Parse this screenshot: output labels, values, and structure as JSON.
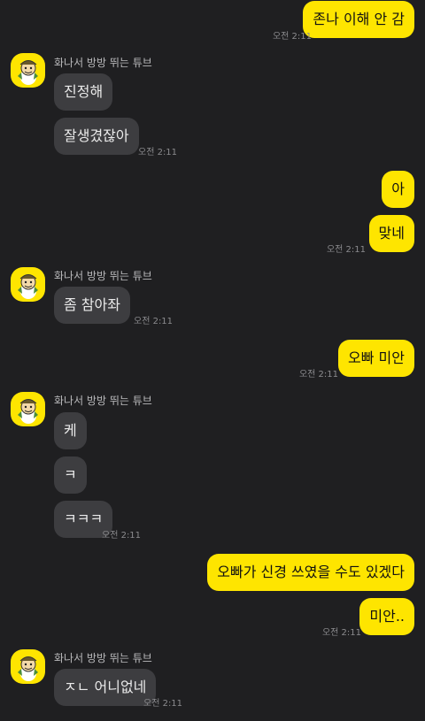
{
  "sender_name": "화나서 방방 뛰는 튜브",
  "messages": [
    {
      "id": "m1",
      "side": "me",
      "text": "존나 이해 안 감",
      "time": "오전 2:11"
    },
    {
      "id": "m2",
      "side": "them",
      "text": "진정해",
      "time": ""
    },
    {
      "id": "m3",
      "side": "them",
      "text": "잘생겼잖아",
      "time": "오전 2:11"
    },
    {
      "id": "m4",
      "side": "me",
      "text": "아",
      "time": ""
    },
    {
      "id": "m5",
      "side": "me",
      "text": "맞네",
      "time": "오전 2:11"
    },
    {
      "id": "m6",
      "side": "them",
      "text": "좀 참아좌",
      "time": "오전 2:11"
    },
    {
      "id": "m7",
      "side": "me",
      "text": "오빠 미안",
      "time": "오전 2:11"
    },
    {
      "id": "m8",
      "side": "them",
      "text": "케",
      "time": ""
    },
    {
      "id": "m9",
      "side": "them",
      "text": "ㅋ",
      "time": ""
    },
    {
      "id": "m10",
      "side": "them",
      "text": "ㅋㅋㅋ",
      "time": "오전 2:11"
    },
    {
      "id": "m11",
      "side": "me",
      "text": "오빠가 신경 쓰였을 수도 있겠다",
      "time": ""
    },
    {
      "id": "m12",
      "side": "me",
      "text": "미안..",
      "time": "오전 2:11"
    },
    {
      "id": "m13",
      "side": "them",
      "text": "ㅈㄴ 어니없네",
      "time": "오전 2:11"
    }
  ],
  "colors": {
    "background": "#1f1f21",
    "my_bubble": "#fee500",
    "their_bubble": "#3d3d40",
    "timestamp": "#8b8b8e"
  },
  "icons": [
    "avatar-tube-icon"
  ]
}
